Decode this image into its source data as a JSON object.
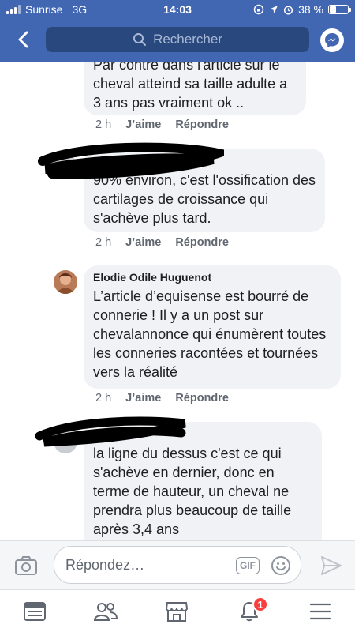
{
  "status_bar": {
    "carrier": "Sunrise",
    "network": "3G",
    "time": "14:03",
    "battery": "38 %"
  },
  "header": {
    "search_placeholder": "Rechercher"
  },
  "comments": [
    {
      "author": "",
      "text": "Par contre dans l'article sur le cheval atteind sa taille adulte a 3 ans pas vraiment ok ..",
      "time": "2 h",
      "like": "J’aime",
      "reply": "Répondre"
    },
    {
      "author": "",
      "text": "90% environ, c'est l'ossification des cartilages de croissance qui s'achève plus tard.",
      "time": "2 h",
      "like": "J’aime",
      "reply": "Répondre"
    },
    {
      "author": "Elodie Odile Huguenot",
      "text": "L’article d’equisense est bourré de connerie ! Il y a un post sur chevalannonce qui énumèrent toutes les conneries racontées et tournées vers la réalité",
      "time": "2 h",
      "like": "J’aime",
      "reply": "Répondre"
    },
    {
      "author": "",
      "text": "la ligne du dessus c'est ce qui s'achève en dernier, donc en terme de hauteur, un cheval ne prendra plus beaucoup de taille après 3,4 ans",
      "time": "",
      "like": "",
      "reply": ""
    }
  ],
  "composer": {
    "placeholder": "Répondez…",
    "gif_label": "GIF"
  },
  "bottom_nav": {
    "notifications_badge": "1"
  },
  "colors": {
    "brand_blue": "#4267b2",
    "bubble_bg": "#f0f2f5",
    "badge_red": "#fa3e3e"
  }
}
